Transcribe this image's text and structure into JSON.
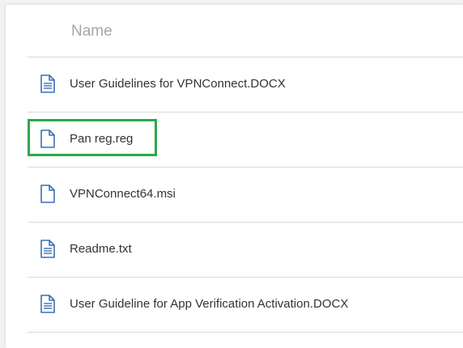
{
  "header": {
    "name_label": "Name"
  },
  "files": [
    {
      "name": "User Guidelines for VPNConnect.DOCX",
      "icon": "document-lines-icon"
    },
    {
      "name": "Pan reg.reg",
      "icon": "blank-file-icon",
      "highlighted": true
    },
    {
      "name": "VPNConnect64.msi",
      "icon": "blank-file-icon"
    },
    {
      "name": "Readme.txt",
      "icon": "document-lines-icon"
    },
    {
      "name": "User Guideline for App Verification Activation.DOCX",
      "icon": "document-lines-icon"
    }
  ],
  "colors": {
    "icon": "#3b6fb6",
    "highlight": "#2ca84a",
    "divider": "#d9d9d9",
    "header_text": "#a6a6a6",
    "row_text": "#333333"
  }
}
